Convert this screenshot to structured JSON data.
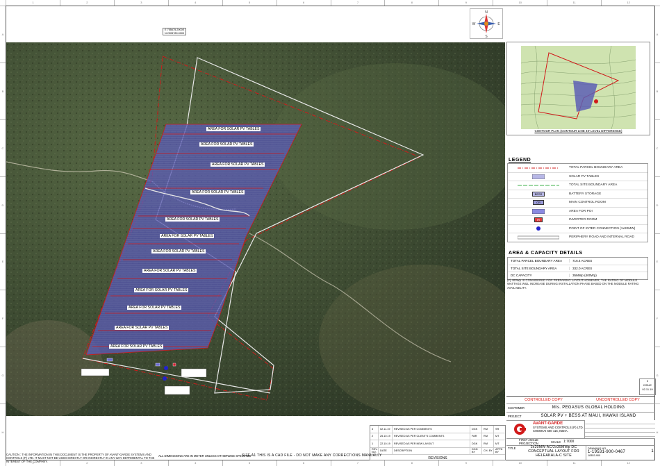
{
  "site_labels": {
    "area_label": "AREA FOR SOLAR PV TABLES",
    "coords": [
      "E 755675.2000E",
      "N 2305780.0000"
    ]
  },
  "north_arrow": {
    "n": "N",
    "s": "S",
    "e": "E",
    "w": "W"
  },
  "inset": {
    "caption": "CONTOUR PLAN (CONTOUR LINE 40' LEVEL DIFFERENCE)"
  },
  "legend": {
    "title": "LEGEND",
    "items": [
      {
        "label": "TOTAL PARCEL BOUNDARY AREA",
        "symbol": "parcel-line-icon"
      },
      {
        "label": "SOLAR PV TABLES",
        "symbol": "pv-table-icon"
      },
      {
        "label": "TOTAL SITE BOUNDARY AREA",
        "symbol": "site-line-icon"
      },
      {
        "label": "BATTERY STORAGE",
        "symbol": "bess-icon",
        "code": "BESS"
      },
      {
        "label": "MAIN CONTROL ROOM",
        "symbol": "control-room-icon",
        "code": "CR"
      },
      {
        "label": "AREA FOR POI",
        "symbol": "poi-area-icon"
      },
      {
        "label": "INVERTER ROOM",
        "symbol": "inverter-icon",
        "code": "IR"
      },
      {
        "label": "POINT OF INTER CONNECTION (1x20MW)",
        "symbol": "poi-dot-icon"
      },
      {
        "label": "PERIPHERY ROAD AND INTERNAL ROAD",
        "symbol": "road-icon"
      }
    ]
  },
  "capacity": {
    "title": "AREA & CAPACITY DETAILS",
    "rows": [
      {
        "label": "TOTAL PARCEL BOUNDARY AREA",
        "value": "716.4 ACRES"
      },
      {
        "label": "TOTAL SITE BOUNDARY AREA",
        "value": "332.0 ACRES"
      },
      {
        "label": "DC CAPACITY",
        "value": "35MWp (400Wp)"
      }
    ],
    "note": "(#) 400Wp IS CONSIDERED FOR PREPARING LAYOUT.HOWEVER, THE RATING OF MODULE WATTAGE WILL INCREASE DURING INSTALLATION PHASE BASED ON THE MODULE RATING AVAILABILITY."
  },
  "title_block": {
    "issue": "ISSUE",
    "issue_date": "02.11.19",
    "controlled": "CONTROLLED COPY",
    "uncontrolled": "UNCONTROLLED COPY",
    "customer_label": "CUSTOMER",
    "customer": "M/s. PEGASUS GLOBAL HOLDING",
    "project_label": "PROJECT",
    "project": "SOLAR PV + BESS AT MAUI, HAWAII ISLAND",
    "company": "AVANT-GARDE",
    "company_sub": "SYSTEMS AND CONTROLS (P) LTD.",
    "company_city": "CHENNAI 600 116, INDIA.",
    "projection": "FIRST ANGLE PROJECTION",
    "scale_label": "SCALE",
    "scale": "1:7000",
    "title_label": "TITLE",
    "title_lines": [
      "2x20MW AC/2x35MWp DC",
      "CONCEPTUAL LAYOUT FOR",
      "HELEAKALA-C SITE"
    ],
    "drawing_no_label": "DRAWING NO.",
    "drawing_no": "1-19531-900-0467",
    "rev": "1",
    "cad_no": "18353-900"
  },
  "revisions": {
    "heading": "REVISIONS",
    "cols": [
      "REV. NO.",
      "DATE",
      "DESCRIPTION",
      "DGN BY",
      "CH. BY",
      "APPD BY"
    ],
    "rows": [
      {
        "no": "3",
        "date": "02.11.19",
        "desc": "REVISED AS PER COMMENTS",
        "d": "DGK",
        "c": "RM",
        "a": "SR"
      },
      {
        "no": "2",
        "date": "25.10.19",
        "desc": "REVISED AS PER CLIENT'S COMMENTS",
        "d": "PAR",
        "c": "RM",
        "a": "MT"
      },
      {
        "no": "1",
        "date": "22.10.19",
        "desc": "REVISED AS PER NEW LAYOUT",
        "d": "DGK",
        "c": "RM",
        "a": "MT"
      }
    ]
  },
  "footer": {
    "caution": "CAUTION : THE INFORMATION IN THIS DOCUMENT IS THE PROPERTY OF AVANT-GARDE SYSTEMS AND CONTROLS (P) LTD. IT MUST NOT BE USED DIRECTLY OR INDIRECTLY IN ANY WAY DETRIMENTAL TO THE INTEREST OF THE COMPANY.",
    "dims": "ALL DIMENSIONS ARE IN METER UNLESS OTHERWISE SPECIFIED",
    "size": "SIZE A1 THIS IS A CAD FILE - DO NOT MAKE ANY CORRECTIONS MANUALLY"
  },
  "colors": {
    "parcel": "#d11a1a",
    "site": "#e8e8e8",
    "pv": "#5d5fb5",
    "road": "#e6e6e6",
    "terrain": "#4a5a3a"
  }
}
